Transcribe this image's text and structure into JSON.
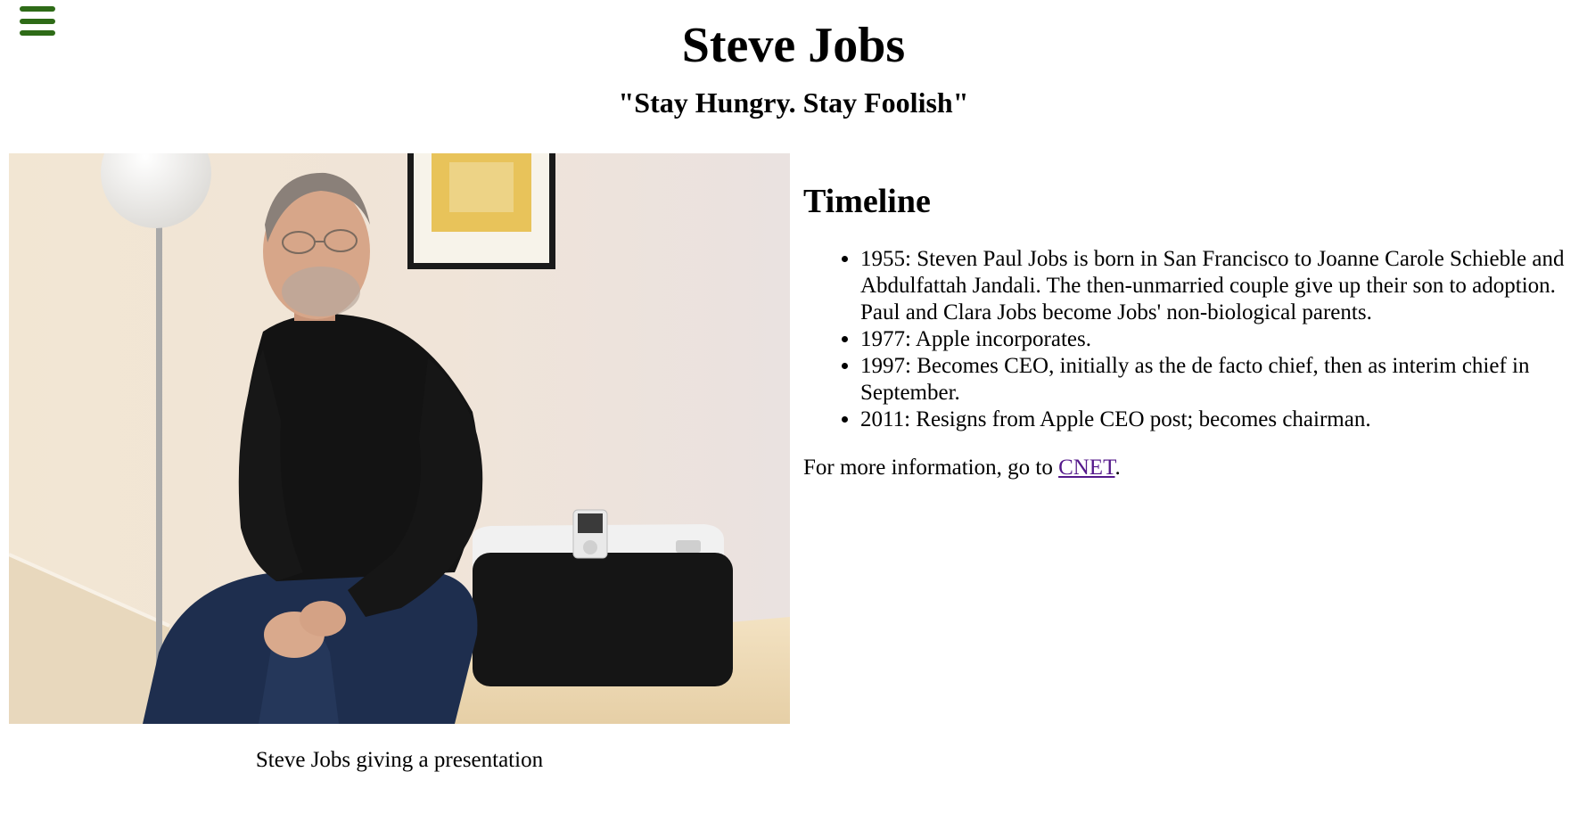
{
  "header": {
    "title": "Steve Jobs",
    "subtitle": "\"Stay Hungry. Stay Foolish\"",
    "menu_icon": "hamburger-menu-icon",
    "menu_color": "#2e6b17"
  },
  "figure": {
    "caption": "Steve Jobs giving a presentation"
  },
  "timeline": {
    "heading": "Timeline",
    "items": [
      "1955: Steven Paul Jobs is born in San Francisco to Joanne Carole Schieble and Abdulfattah Jandali. The then-unmarried couple give up their son to adoption. Paul and Clara Jobs become Jobs' non-biological parents.",
      "1977: Apple incorporates.",
      "1997: Becomes CEO, initially as the de facto chief, then as interim chief in September.",
      "2011: Resigns from Apple CEO post; becomes chairman."
    ],
    "more_info_prefix": "For more information, go to ",
    "more_info_link": "CNET",
    "more_info_suffix": ".",
    "link_color": "#551a8b"
  }
}
